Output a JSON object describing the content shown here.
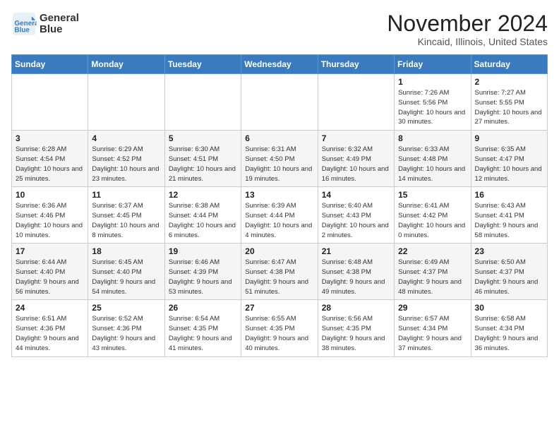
{
  "logo": {
    "line1": "General",
    "line2": "Blue"
  },
  "title": "November 2024",
  "location": "Kincaid, Illinois, United States",
  "days_of_week": [
    "Sunday",
    "Monday",
    "Tuesday",
    "Wednesday",
    "Thursday",
    "Friday",
    "Saturday"
  ],
  "weeks": [
    [
      {
        "day": "",
        "info": ""
      },
      {
        "day": "",
        "info": ""
      },
      {
        "day": "",
        "info": ""
      },
      {
        "day": "",
        "info": ""
      },
      {
        "day": "",
        "info": ""
      },
      {
        "day": "1",
        "info": "Sunrise: 7:26 AM\nSunset: 5:56 PM\nDaylight: 10 hours and 30 minutes."
      },
      {
        "day": "2",
        "info": "Sunrise: 7:27 AM\nSunset: 5:55 PM\nDaylight: 10 hours and 27 minutes."
      }
    ],
    [
      {
        "day": "3",
        "info": "Sunrise: 6:28 AM\nSunset: 4:54 PM\nDaylight: 10 hours and 25 minutes."
      },
      {
        "day": "4",
        "info": "Sunrise: 6:29 AM\nSunset: 4:52 PM\nDaylight: 10 hours and 23 minutes."
      },
      {
        "day": "5",
        "info": "Sunrise: 6:30 AM\nSunset: 4:51 PM\nDaylight: 10 hours and 21 minutes."
      },
      {
        "day": "6",
        "info": "Sunrise: 6:31 AM\nSunset: 4:50 PM\nDaylight: 10 hours and 19 minutes."
      },
      {
        "day": "7",
        "info": "Sunrise: 6:32 AM\nSunset: 4:49 PM\nDaylight: 10 hours and 16 minutes."
      },
      {
        "day": "8",
        "info": "Sunrise: 6:33 AM\nSunset: 4:48 PM\nDaylight: 10 hours and 14 minutes."
      },
      {
        "day": "9",
        "info": "Sunrise: 6:35 AM\nSunset: 4:47 PM\nDaylight: 10 hours and 12 minutes."
      }
    ],
    [
      {
        "day": "10",
        "info": "Sunrise: 6:36 AM\nSunset: 4:46 PM\nDaylight: 10 hours and 10 minutes."
      },
      {
        "day": "11",
        "info": "Sunrise: 6:37 AM\nSunset: 4:45 PM\nDaylight: 10 hours and 8 minutes."
      },
      {
        "day": "12",
        "info": "Sunrise: 6:38 AM\nSunset: 4:44 PM\nDaylight: 10 hours and 6 minutes."
      },
      {
        "day": "13",
        "info": "Sunrise: 6:39 AM\nSunset: 4:44 PM\nDaylight: 10 hours and 4 minutes."
      },
      {
        "day": "14",
        "info": "Sunrise: 6:40 AM\nSunset: 4:43 PM\nDaylight: 10 hours and 2 minutes."
      },
      {
        "day": "15",
        "info": "Sunrise: 6:41 AM\nSunset: 4:42 PM\nDaylight: 10 hours and 0 minutes."
      },
      {
        "day": "16",
        "info": "Sunrise: 6:43 AM\nSunset: 4:41 PM\nDaylight: 9 hours and 58 minutes."
      }
    ],
    [
      {
        "day": "17",
        "info": "Sunrise: 6:44 AM\nSunset: 4:40 PM\nDaylight: 9 hours and 56 minutes."
      },
      {
        "day": "18",
        "info": "Sunrise: 6:45 AM\nSunset: 4:40 PM\nDaylight: 9 hours and 54 minutes."
      },
      {
        "day": "19",
        "info": "Sunrise: 6:46 AM\nSunset: 4:39 PM\nDaylight: 9 hours and 53 minutes."
      },
      {
        "day": "20",
        "info": "Sunrise: 6:47 AM\nSunset: 4:38 PM\nDaylight: 9 hours and 51 minutes."
      },
      {
        "day": "21",
        "info": "Sunrise: 6:48 AM\nSunset: 4:38 PM\nDaylight: 9 hours and 49 minutes."
      },
      {
        "day": "22",
        "info": "Sunrise: 6:49 AM\nSunset: 4:37 PM\nDaylight: 9 hours and 48 minutes."
      },
      {
        "day": "23",
        "info": "Sunrise: 6:50 AM\nSunset: 4:37 PM\nDaylight: 9 hours and 46 minutes."
      }
    ],
    [
      {
        "day": "24",
        "info": "Sunrise: 6:51 AM\nSunset: 4:36 PM\nDaylight: 9 hours and 44 minutes."
      },
      {
        "day": "25",
        "info": "Sunrise: 6:52 AM\nSunset: 4:36 PM\nDaylight: 9 hours and 43 minutes."
      },
      {
        "day": "26",
        "info": "Sunrise: 6:54 AM\nSunset: 4:35 PM\nDaylight: 9 hours and 41 minutes."
      },
      {
        "day": "27",
        "info": "Sunrise: 6:55 AM\nSunset: 4:35 PM\nDaylight: 9 hours and 40 minutes."
      },
      {
        "day": "28",
        "info": "Sunrise: 6:56 AM\nSunset: 4:35 PM\nDaylight: 9 hours and 38 minutes."
      },
      {
        "day": "29",
        "info": "Sunrise: 6:57 AM\nSunset: 4:34 PM\nDaylight: 9 hours and 37 minutes."
      },
      {
        "day": "30",
        "info": "Sunrise: 6:58 AM\nSunset: 4:34 PM\nDaylight: 9 hours and 36 minutes."
      }
    ]
  ]
}
